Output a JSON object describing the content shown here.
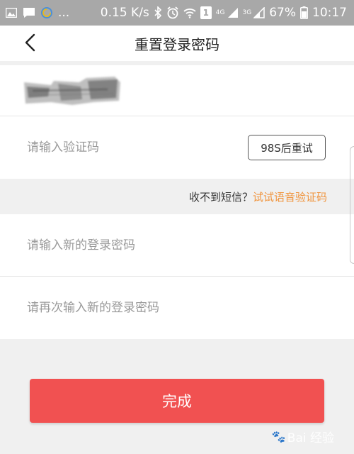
{
  "status_bar": {
    "dots": "...",
    "network_speed": "0.15 K/s",
    "sim_badge": "1",
    "net_4g": "4G",
    "net_3g": "3G",
    "battery": "67%",
    "time": "10:17"
  },
  "header": {
    "title": "重置登录密码"
  },
  "form": {
    "code_placeholder": "请输入验证码",
    "retry_label": "98S后重试",
    "hint_text": "收不到短信？",
    "voice_link": "试试语音验证码",
    "new_password_placeholder": "请输入新的登录密码",
    "confirm_password_placeholder": "请再次输入新的登录密码",
    "done_label": "完成"
  },
  "watermark": {
    "text": "Bai 经验"
  },
  "colors": {
    "accent": "#f15151",
    "link": "#f0943d",
    "status_bar": "#a8a8a8"
  }
}
